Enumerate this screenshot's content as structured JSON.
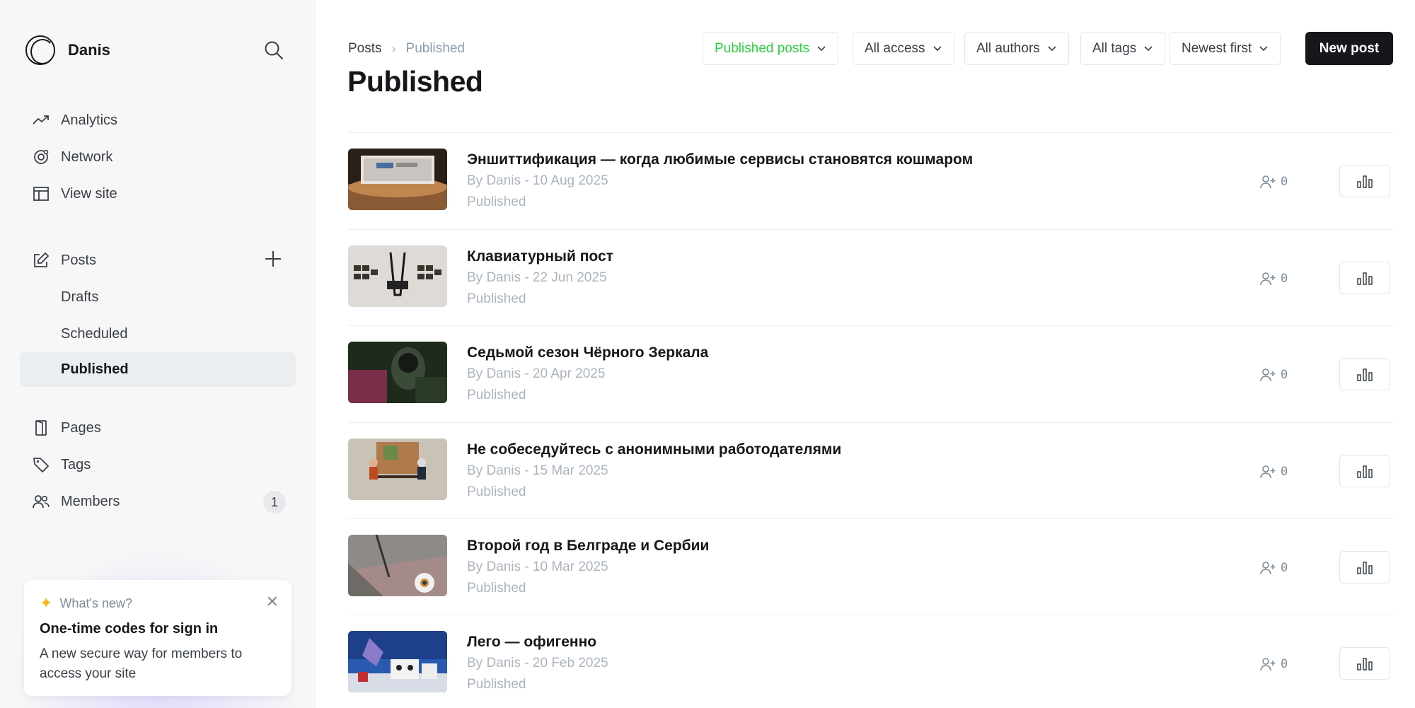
{
  "site": {
    "name": "Danis"
  },
  "sidebar": {
    "nav": [
      {
        "label": "Analytics",
        "icon": "analytics-icon"
      },
      {
        "label": "Network",
        "icon": "network-icon"
      },
      {
        "label": "View site",
        "icon": "view-site-icon"
      }
    ],
    "posts": {
      "label": "Posts",
      "icon": "posts-icon"
    },
    "posts_sub": [
      "Drafts",
      "Scheduled",
      "Published"
    ],
    "active_sub": "Published",
    "pages": {
      "label": "Pages",
      "icon": "pages-icon"
    },
    "tags": {
      "label": "Tags",
      "icon": "tags-icon"
    },
    "members": {
      "label": "Members",
      "icon": "members-icon",
      "count": "1"
    }
  },
  "whats_new": {
    "heading": "What's new?",
    "title": "One-time codes for sign in",
    "body": "A new secure way for members to access your site"
  },
  "breadcrumb": {
    "parent": "Posts",
    "current": "Published"
  },
  "page_title": "Published",
  "filters": {
    "type": "Published posts",
    "access": "All access",
    "authors": "All authors",
    "tags": "All tags",
    "sort": "Newest first"
  },
  "new_post_label": "New post",
  "colors": {
    "accent_green": "#30cf43",
    "primary_dark": "#15171a",
    "muted": "#abb4be"
  },
  "posts": [
    {
      "title": "Эншиттификация — когда любимые сервисы становятся кошмаром",
      "meta": "By Danis - 10 Aug 2025",
      "status": "Published",
      "members": "0"
    },
    {
      "title": "Клавиатурный пост",
      "meta": "By Danis - 22 Jun 2025",
      "status": "Published",
      "members": "0"
    },
    {
      "title": "Седьмой сезон Чёрного Зеркала",
      "meta": "By Danis - 20 Apr 2025",
      "status": "Published",
      "members": "0"
    },
    {
      "title": "Не собеседуйтесь с анонимными работодателями",
      "meta": "By Danis - 15 Mar 2025",
      "status": "Published",
      "members": "0"
    },
    {
      "title": "Второй год в Белграде и Сербии",
      "meta": "By Danis - 10 Mar 2025",
      "status": "Published",
      "members": "0"
    },
    {
      "title": "Лего — офигенно",
      "meta": "By Danis - 20 Feb 2025",
      "status": "Published",
      "members": "0"
    }
  ]
}
